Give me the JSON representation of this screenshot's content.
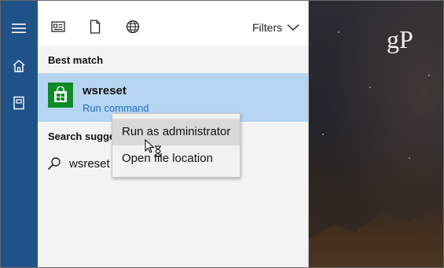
{
  "rail": {
    "items": [
      {
        "icon": "hamburger-menu-icon"
      },
      {
        "icon": "home-icon"
      },
      {
        "icon": "notebook-icon"
      }
    ],
    "color": "#1f5289"
  },
  "toolbar": {
    "icons": [
      "news-app-icon",
      "document-icon",
      "globe-icon"
    ],
    "filters_label": "Filters"
  },
  "sections": {
    "best_match": "Best match",
    "suggestions": "Search sugges"
  },
  "best_match_result": {
    "title": "wsreset",
    "subtitle": "Run command",
    "tile_color": "#0f8a27",
    "highlight_color": "#b6d5f1"
  },
  "suggestion": {
    "text": "wsreset"
  },
  "context_menu": {
    "items": [
      {
        "label": "Run as administrator",
        "highlighted": true
      },
      {
        "label": "Open file location",
        "highlighted": false
      }
    ]
  },
  "watermark": {
    "text": "gP"
  }
}
